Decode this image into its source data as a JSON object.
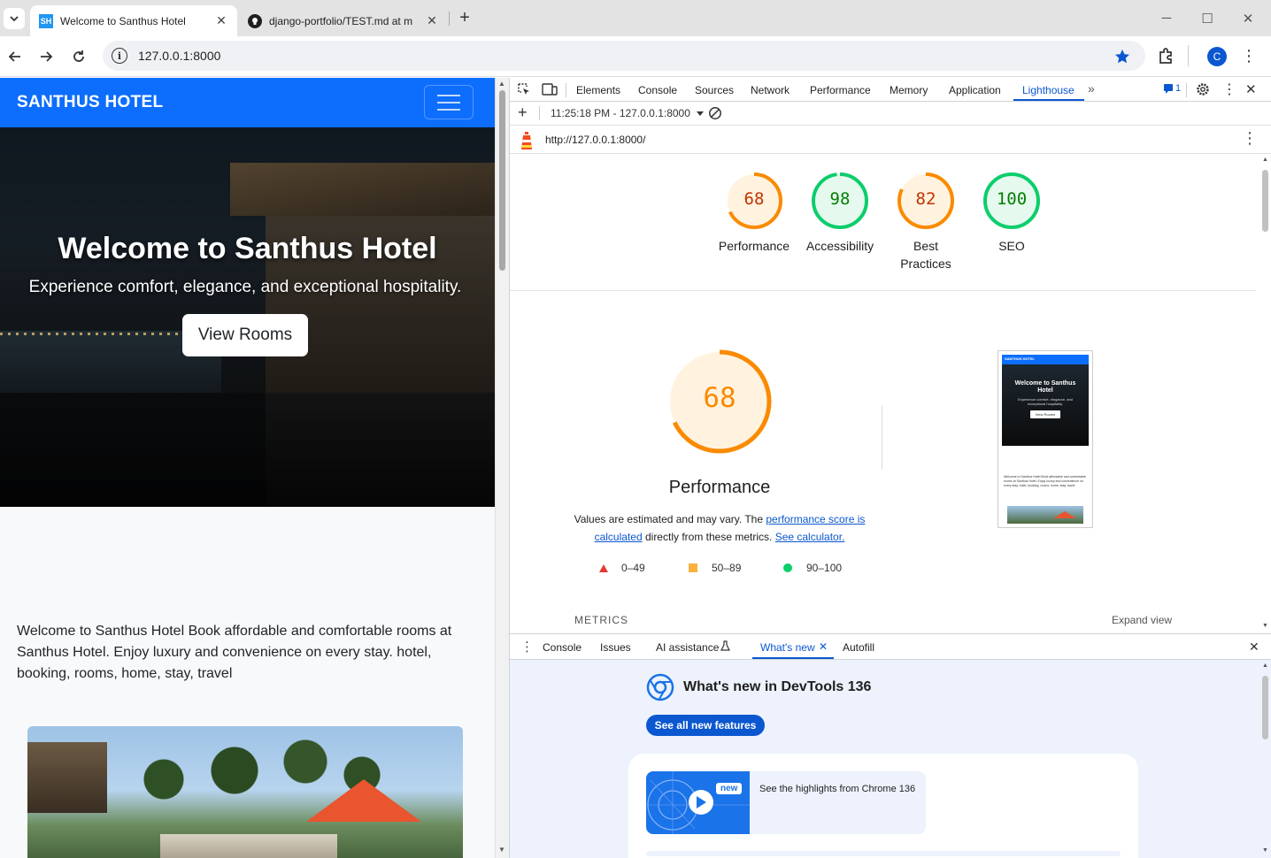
{
  "browser": {
    "tabs": [
      {
        "title": "Welcome to Santhus Hotel",
        "favicon_text": "SH",
        "active": true
      },
      {
        "title": "django-portfolio/TEST.md at m",
        "active": false
      }
    ],
    "new_tab_label": "+",
    "url": "127.0.0.1:8000",
    "profile_initial": "C"
  },
  "site": {
    "brand": "SANTHUS HOTEL",
    "hero_title": "Welcome to Santhus Hotel",
    "hero_subtitle": "Experience comfort, elegance, and exceptional hospitality.",
    "hero_button": "View Rooms",
    "intro_text": "Welcome to Santhus Hotel Book affordable and comfortable rooms at Santhus Hotel. Enjoy luxury and convenience on every stay. hotel, booking, rooms, home, stay, travel"
  },
  "devtools": {
    "tabs": [
      "Elements",
      "Console",
      "Sources",
      "Network",
      "Performance",
      "Memory",
      "Application",
      "Lighthouse"
    ],
    "active_tab": "Lighthouse",
    "issues_count": "1",
    "report_select": "11:25:18 PM - 127.0.0.1:8000",
    "report_url": "http://127.0.0.1:8000/",
    "scores": [
      {
        "name": "Performance",
        "score": 68,
        "color": "#fa8a00",
        "fill_color": "#fff3e0",
        "text_color": "#c33300"
      },
      {
        "name": "Accessibility",
        "score": 98,
        "color": "#0cce6b",
        "fill_color": "#e6f9ef",
        "text_color": "#008000"
      },
      {
        "name": "Best Practices",
        "score": 82,
        "color": "#fa8a00",
        "fill_color": "#fff3e0",
        "text_color": "#c33300"
      },
      {
        "name": "SEO",
        "score": 100,
        "color": "#0cce6b",
        "fill_color": "#e6f9ef",
        "text_color": "#008000"
      }
    ],
    "perf": {
      "score": 68,
      "title": "Performance",
      "desc_before": "Values are estimated and may vary. The ",
      "desc_link1": "performance score is calculated",
      "desc_middle": " directly from these metrics. ",
      "desc_link2": "See calculator.",
      "legend": [
        {
          "range": "0–49",
          "color": "#e53935"
        },
        {
          "range": "50–89",
          "color": "#fbb040"
        },
        {
          "range": "90–100",
          "color": "#0cce6b"
        }
      ]
    },
    "thumb": {
      "brand": "SANTHUS HOTEL",
      "hero_title": "Welcome to Santhus Hotel",
      "hero_subtitle": "Experience comfort, elegance, and exceptional hospitality.",
      "button": "View Rooms",
      "text": "Welcome to Santhus Hotel Book affordable and comfortable rooms at Santhus Hotel. Enjoy luxury and convenience on every stay. hotel, booking, rooms, home, stay, travel"
    },
    "metrics_label": "METRICS",
    "expand_view": "Expand view",
    "drawer_tabs": [
      "Console",
      "Issues",
      "AI assistance",
      "What's new",
      "Autofill"
    ],
    "whats_new": {
      "title": "What's new in DevTools 136",
      "button": "See all new features",
      "badge": "new",
      "highlight": "See the highlights from Chrome 136"
    }
  }
}
